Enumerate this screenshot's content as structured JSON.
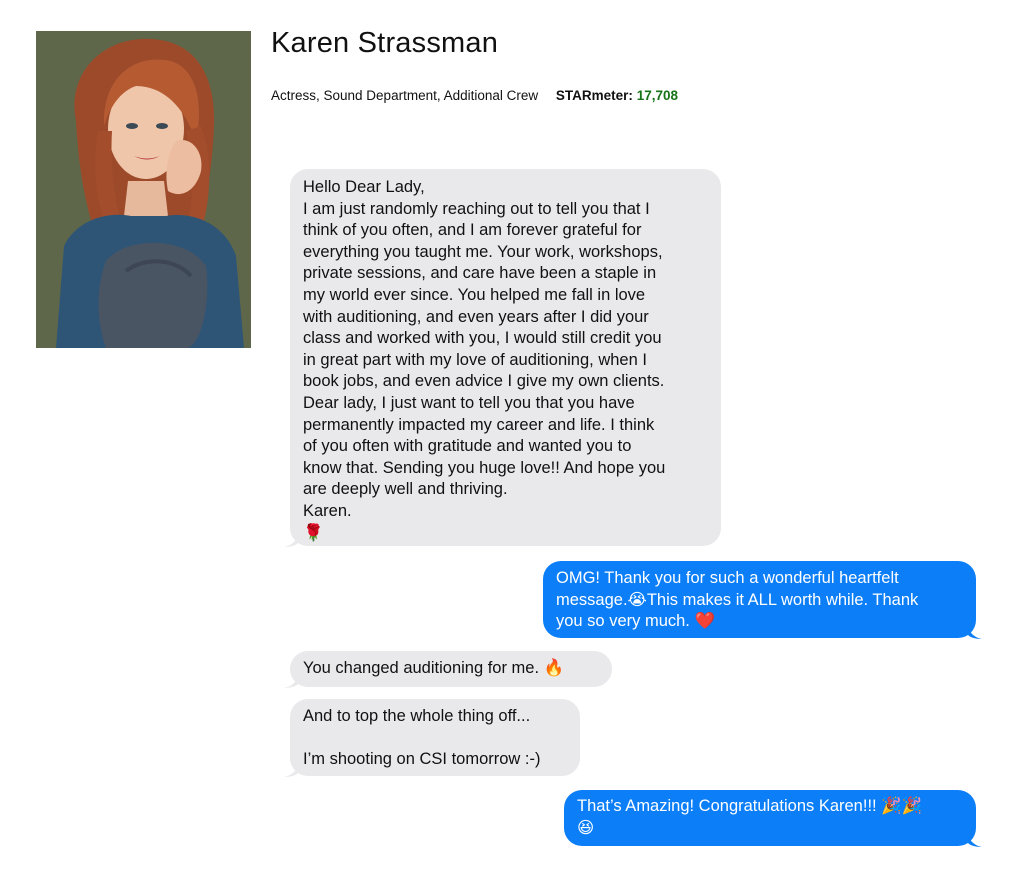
{
  "profile": {
    "name": "Karen Strassman",
    "roles": "Actress, Sound Department, Additional Crew",
    "starmeter_label": "STARmeter:",
    "starmeter_value": "17,708"
  },
  "messages": [
    {
      "direction": "incoming",
      "lines": [
        "Hello Dear Lady,",
        "I am just randomly reaching out to tell you that I",
        "think of you often, and I am forever grateful for",
        "everything you taught me. Your work, workshops,",
        "private sessions, and care have been a staple in",
        "my world ever since. You helped me fall in love",
        "with auditioning, and even years after I did your",
        "class and worked with you, I would still credit you",
        "in great part with my love of auditioning, when I",
        "book jobs, and even advice I give my own clients.",
        "Dear lady, I just want to tell you that you have",
        "permanently impacted my career and life. I think",
        "of you often with gratitude and wanted you to",
        "know that. Sending you huge love!! And hope you",
        "are deeply well and thriving.",
        "Karen."
      ],
      "emoji": "🌹"
    },
    {
      "direction": "outgoing",
      "lines": [
        "OMG! Thank you for such a wonderful heartfelt",
        "message.😭This makes it ALL worth while. Thank",
        "you so very much. ❤️"
      ]
    },
    {
      "direction": "incoming",
      "lines": [
        "You changed auditioning for me.  🔥"
      ]
    },
    {
      "direction": "incoming",
      "lines": [
        "And to top the whole thing off...",
        "",
        "I’m shooting on CSI tomorrow :-)"
      ]
    },
    {
      "direction": "outgoing",
      "lines": [
        "That’s Amazing! Congratulations Karen!!! 🎉🎉",
        "😆"
      ]
    }
  ],
  "colors": {
    "incoming_bubble": "#e9e9eb",
    "outgoing_bubble": "#0b7ef8",
    "starmeter_value": "#167317"
  }
}
